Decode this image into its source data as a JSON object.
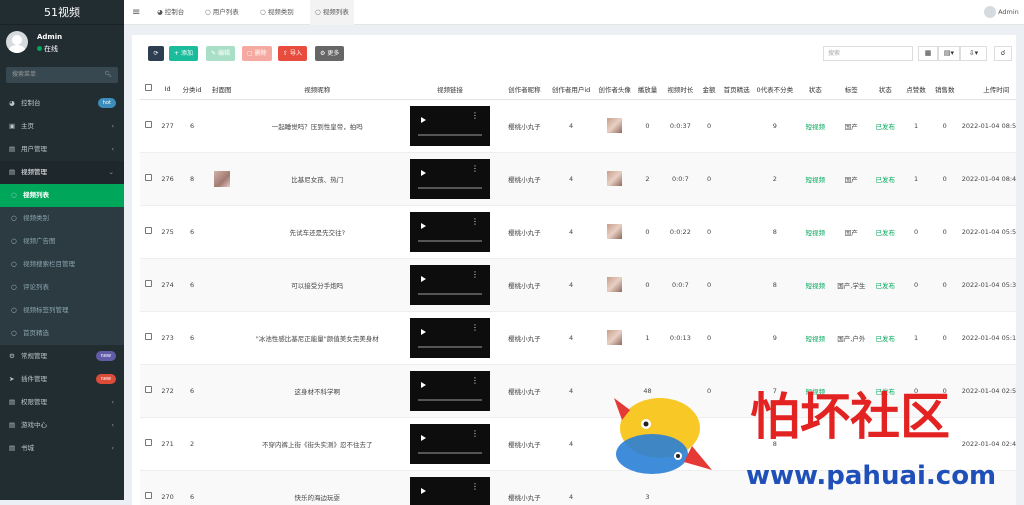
{
  "app": {
    "title": "51视频"
  },
  "user": {
    "name": "Admin",
    "status": "在线"
  },
  "sidebar": {
    "search_placeholder": "搜索菜单",
    "items": [
      {
        "label": "控制台",
        "icon": "dashboard-icon",
        "badge": "hot",
        "badge_color": "#3c8dbc"
      },
      {
        "label": "主页",
        "icon": "home-icon"
      },
      {
        "label": "用户管理",
        "icon": "users-icon"
      },
      {
        "label": "视频管理",
        "icon": "video-icon"
      },
      {
        "label": "常规管理",
        "icon": "settings-icon",
        "badge": "new",
        "badge_color": "#605ca8"
      },
      {
        "label": "插件管理",
        "icon": "plugin-icon",
        "badge": "new",
        "badge_color": "#dd4b39"
      },
      {
        "label": "权限管理",
        "icon": "permission-icon"
      },
      {
        "label": "游戏中心",
        "icon": "game-icon"
      },
      {
        "label": "书城",
        "icon": "book-icon"
      }
    ],
    "sub_items": [
      "视频列表",
      "视频类别",
      "视频广告图",
      "视频搜索栏目管理",
      "评论列表",
      "视频标签列管理",
      "首页精选"
    ]
  },
  "topbar": {
    "tabs": [
      "控制台",
      "用户列表",
      "视频类别",
      "视频列表"
    ],
    "user": "Admin"
  },
  "toolbar": {
    "refresh": "",
    "add": "添加",
    "edit": "编辑",
    "delete": "删除",
    "import": "导入",
    "more": "更多",
    "search_placeholder": "搜索"
  },
  "table": {
    "columns": [
      "Id",
      "分类id",
      "封面图",
      "视频昵称",
      "视频链接",
      "创作者昵称",
      "创作者用户id",
      "创作者头像",
      "播放量",
      "视频时长",
      "金额",
      "首页精选",
      "0代表不分类",
      "状态",
      "标签",
      "状态",
      "点赞数",
      "销售数",
      "上传时间"
    ],
    "rows": [
      {
        "id": "277",
        "cat": "6",
        "cover": false,
        "name": "一起睡觉吗？压到性皇帝，拍吗",
        "creator": "樱桃小丸子",
        "uid": "4",
        "avatar": true,
        "plays": "0",
        "duration": "0:0:37",
        "amount": "0",
        "featured": "",
        "cls": "9",
        "status": "短视频",
        "tag": "国产",
        "state": "已发布",
        "likes": "1",
        "sales": "0",
        "time": "2022-01-04 08:50:52"
      },
      {
        "id": "276",
        "cat": "8",
        "cover": true,
        "name": "比基尼女孩、热门",
        "creator": "樱桃小丸子",
        "uid": "4",
        "avatar": true,
        "plays": "2",
        "duration": "0:0:7",
        "amount": "0",
        "featured": "",
        "cls": "2",
        "status": "短视频",
        "tag": "国产",
        "state": "已发布",
        "likes": "1",
        "sales": "0",
        "time": "2022-01-04 08:44:20"
      },
      {
        "id": "275",
        "cat": "6",
        "cover": false,
        "name": "先试车还是先交往?",
        "creator": "樱桃小丸子",
        "uid": "4",
        "avatar": true,
        "plays": "0",
        "duration": "0:0:22",
        "amount": "0",
        "featured": "",
        "cls": "8",
        "status": "短视频",
        "tag": "国产",
        "state": "已发布",
        "likes": "0",
        "sales": "0",
        "time": "2022-01-04 05:59:03"
      },
      {
        "id": "274",
        "cat": "6",
        "cover": false,
        "name": "可以接受分手炮吗",
        "creator": "樱桃小丸子",
        "uid": "4",
        "avatar": true,
        "plays": "0",
        "duration": "0:0:7",
        "amount": "0",
        "featured": "",
        "cls": "8",
        "status": "短视频",
        "tag": "国产,学生",
        "state": "已发布",
        "likes": "0",
        "sales": "0",
        "time": "2022-01-04 05:37:37"
      },
      {
        "id": "273",
        "cat": "6",
        "cover": false,
        "name": "\"冰池性感比基尼正能量\"颜值美女完美身材",
        "creator": "樱桃小丸子",
        "uid": "4",
        "avatar": true,
        "plays": "1",
        "duration": "0:0:13",
        "amount": "0",
        "featured": "",
        "cls": "9",
        "status": "短视频",
        "tag": "国产,户外",
        "state": "已发布",
        "likes": "1",
        "sales": "0",
        "time": "2022-01-04 05:19:04"
      },
      {
        "id": "272",
        "cat": "6",
        "cover": false,
        "name": "这身材不科学啊",
        "creator": "樱桃小丸子",
        "uid": "4",
        "avatar": false,
        "plays": "48",
        "duration": "",
        "amount": "0",
        "featured": "",
        "cls": "7",
        "status": "短视频",
        "tag": "",
        "state": "已发布",
        "likes": "0",
        "sales": "0",
        "time": "2022-01-04 02:53:42"
      },
      {
        "id": "271",
        "cat": "2",
        "cover": false,
        "name": "不穿内裤上街《街头实测》忍不住去了",
        "creator": "樱桃小丸子",
        "uid": "4",
        "avatar": false,
        "plays": "123",
        "duration": "",
        "amount": "",
        "featured": "",
        "cls": "8",
        "status": "",
        "tag": "",
        "state": "",
        "likes": "",
        "sales": "",
        "time": "2022-01-04 02:46:10"
      },
      {
        "id": "270",
        "cat": "6",
        "cover": false,
        "name": "快乐的海边玩耍",
        "creator": "樱桃小丸子",
        "uid": "4",
        "avatar": false,
        "plays": "3",
        "duration": "",
        "amount": "",
        "featured": "",
        "cls": "",
        "status": "",
        "tag": "",
        "state": "",
        "likes": "",
        "sales": "",
        "time": ""
      }
    ]
  },
  "watermark": {
    "title": "怕坏社区",
    "url": "www.pahuai.com"
  },
  "colors": {
    "sidebar": "#222d32",
    "active": "#00a65a",
    "primary": "#3c8dbc",
    "success": "#00a65a",
    "danger": "#f56954",
    "edit": "#a8dfc6"
  }
}
